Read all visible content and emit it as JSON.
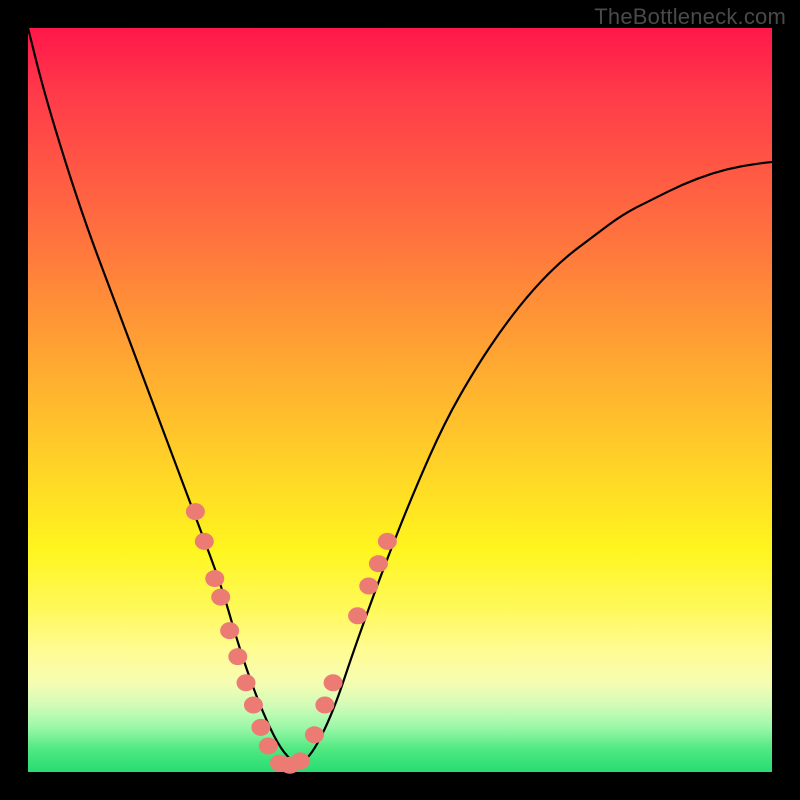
{
  "watermark": "TheBottleneck.com",
  "colors": {
    "background": "#000000",
    "gradient_top": "#ff174a",
    "gradient_bottom": "#27dd72",
    "curve": "#000000",
    "markers": "#ec7b74"
  },
  "chart_data": {
    "type": "line",
    "title": "",
    "xlabel": "",
    "ylabel": "",
    "xlim": [
      0,
      100
    ],
    "ylim": [
      0,
      100
    ],
    "x": [
      0,
      2,
      5,
      8,
      11,
      14,
      17,
      20,
      23,
      26,
      28,
      30,
      32,
      34,
      36,
      38,
      41,
      44,
      48,
      52,
      56,
      60,
      64,
      68,
      72,
      76,
      80,
      84,
      88,
      92,
      96,
      100
    ],
    "values": [
      100,
      92,
      82,
      73,
      65,
      57,
      49,
      41,
      33,
      25,
      18,
      12,
      7,
      3,
      1,
      2,
      8,
      17,
      28,
      38,
      47,
      54,
      60,
      65,
      69,
      72,
      75,
      77,
      79,
      80.5,
      81.5,
      82
    ],
    "series": [
      {
        "name": "markers-left",
        "values": [
          {
            "x": 22.5,
            "y": 35
          },
          {
            "x": 23.7,
            "y": 31
          },
          {
            "x": 25.1,
            "y": 26
          },
          {
            "x": 25.9,
            "y": 23.5
          },
          {
            "x": 27.1,
            "y": 19
          },
          {
            "x": 28.2,
            "y": 15.5
          },
          {
            "x": 29.3,
            "y": 12
          },
          {
            "x": 30.3,
            "y": 9
          },
          {
            "x": 31.3,
            "y": 6
          },
          {
            "x": 32.3,
            "y": 3.5
          }
        ]
      },
      {
        "name": "markers-bottom",
        "values": [
          {
            "x": 33.8,
            "y": 1.2
          },
          {
            "x": 35.2,
            "y": 0.9
          },
          {
            "x": 36.6,
            "y": 1.5
          }
        ]
      },
      {
        "name": "markers-right",
        "values": [
          {
            "x": 38.5,
            "y": 5
          },
          {
            "x": 39.9,
            "y": 9
          },
          {
            "x": 41.0,
            "y": 12
          },
          {
            "x": 44.3,
            "y": 21
          },
          {
            "x": 45.8,
            "y": 25
          },
          {
            "x": 47.1,
            "y": 28
          },
          {
            "x": 48.3,
            "y": 31
          }
        ]
      }
    ]
  }
}
